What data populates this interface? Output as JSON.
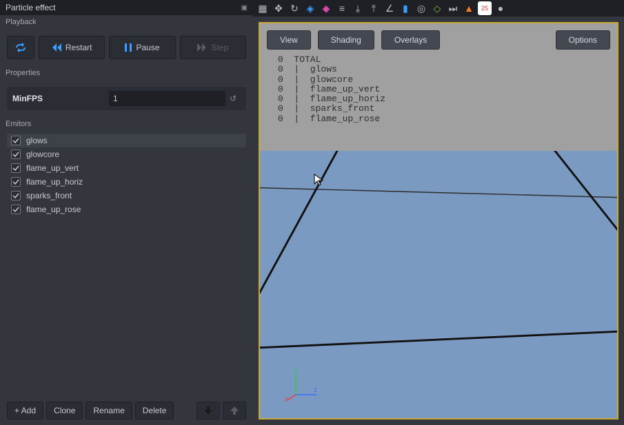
{
  "panel_title": "Particle effect",
  "sections": {
    "playback": "Playback",
    "properties": "Properties",
    "emitors": "Emitors"
  },
  "playback": {
    "loop_on": true,
    "restart": "Restart",
    "pause": "Pause",
    "step": "Step"
  },
  "properties": {
    "minfps_label": "MinFPS",
    "minfps_value": "1"
  },
  "emitors": [
    {
      "name": "glows",
      "checked": true,
      "selected": true
    },
    {
      "name": "glowcore",
      "checked": true,
      "selected": false
    },
    {
      "name": "flame_up_vert",
      "checked": true,
      "selected": false
    },
    {
      "name": "flame_up_horiz",
      "checked": true,
      "selected": false
    },
    {
      "name": "sparks_front",
      "checked": true,
      "selected": false
    },
    {
      "name": "flame_up_rose",
      "checked": true,
      "selected": false
    }
  ],
  "emitor_footer": {
    "add": "+ Add",
    "clone": "Clone",
    "rename": "Rename",
    "delete": "Delete"
  },
  "viewport_buttons": {
    "view": "View",
    "shading": "Shading",
    "overlays": "Overlays",
    "options": "Options"
  },
  "stats_lines": [
    "0  TOTAL",
    "0  |  glows",
    "0  |  glowcore",
    "0  |  flame_up_vert",
    "0  |  flame_up_horiz",
    "0  |  sparks_front",
    "0  |  flame_up_rose"
  ],
  "gizmo": {
    "x": "X",
    "y": "Y",
    "z": "Z"
  },
  "toolbar_icons": [
    "grid-icon",
    "move-icon",
    "refresh-icon",
    "cube-icon",
    "diamond-icon",
    "grill-icon",
    "download-icon",
    "upload-icon",
    "angle-icon",
    "bars-icon",
    "globe-icon",
    "leaf-icon",
    "skip-icon",
    "warning-icon",
    "counter-icon",
    "mic-icon"
  ],
  "colors": {
    "accent": "#3aa0ff",
    "frame": "#c9a933",
    "sky": "#7a9ac2"
  }
}
